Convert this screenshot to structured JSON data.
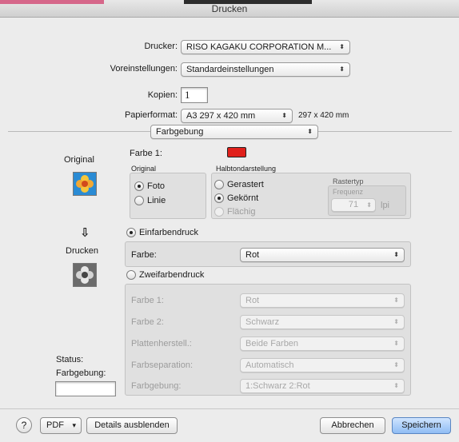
{
  "window": {
    "title": "Drucken"
  },
  "printer": {
    "label": "Drucker:",
    "value": "RISO KAGAKU CORPORATION M..."
  },
  "presets": {
    "label": "Voreinstellungen:",
    "value": "Standardeinstellungen"
  },
  "copies": {
    "label": "Kopien:",
    "value": "1"
  },
  "paper": {
    "label": "Papierformat:",
    "value": "A3 297 x 420 mm",
    "size_text": "297 x 420 mm"
  },
  "panel": {
    "value": "Farbgebung"
  },
  "left": {
    "original_label": "Original",
    "arrow": "⇩",
    "print_label": "Drucken",
    "status_label": "Status:",
    "colouring_label": "Farbgebung:"
  },
  "colour1": {
    "label": "Farbe 1:",
    "swatch": "#e0201b"
  },
  "original_group": {
    "title": "Original",
    "photo": "Foto",
    "line": "Linie"
  },
  "halftone_group": {
    "title": "Halbtondarstellung",
    "opt1": "Gerastert",
    "opt2": "Gekörnt",
    "opt3": "Flächig",
    "screen_type_label": "Rastertyp",
    "frequency_label": "Frequenz",
    "frequency_value": "71",
    "frequency_unit": "lpi"
  },
  "single": {
    "label": "Einfarbendruck",
    "colour_label": "Farbe:",
    "colour_value": "Rot"
  },
  "dual": {
    "label": "Zweifarbendruck",
    "rows": [
      {
        "label": "Farbe 1:",
        "value": "Rot"
      },
      {
        "label": "Farbe 2:",
        "value": "Schwarz"
      },
      {
        "label": "Plattenherstell.:",
        "value": "Beide Farben"
      },
      {
        "label": "Farbseparation:",
        "value": "Automatisch"
      },
      {
        "label": "Farbgebung:",
        "value": "1:Schwarz 2:Rot"
      }
    ]
  },
  "footer": {
    "help": "?",
    "pdf": "PDF",
    "pdf_arrow": "▾",
    "details": "Details ausblenden",
    "cancel": "Abbrechen",
    "save": "Speichern"
  },
  "icons": {
    "popup_arrow": "⬍"
  }
}
